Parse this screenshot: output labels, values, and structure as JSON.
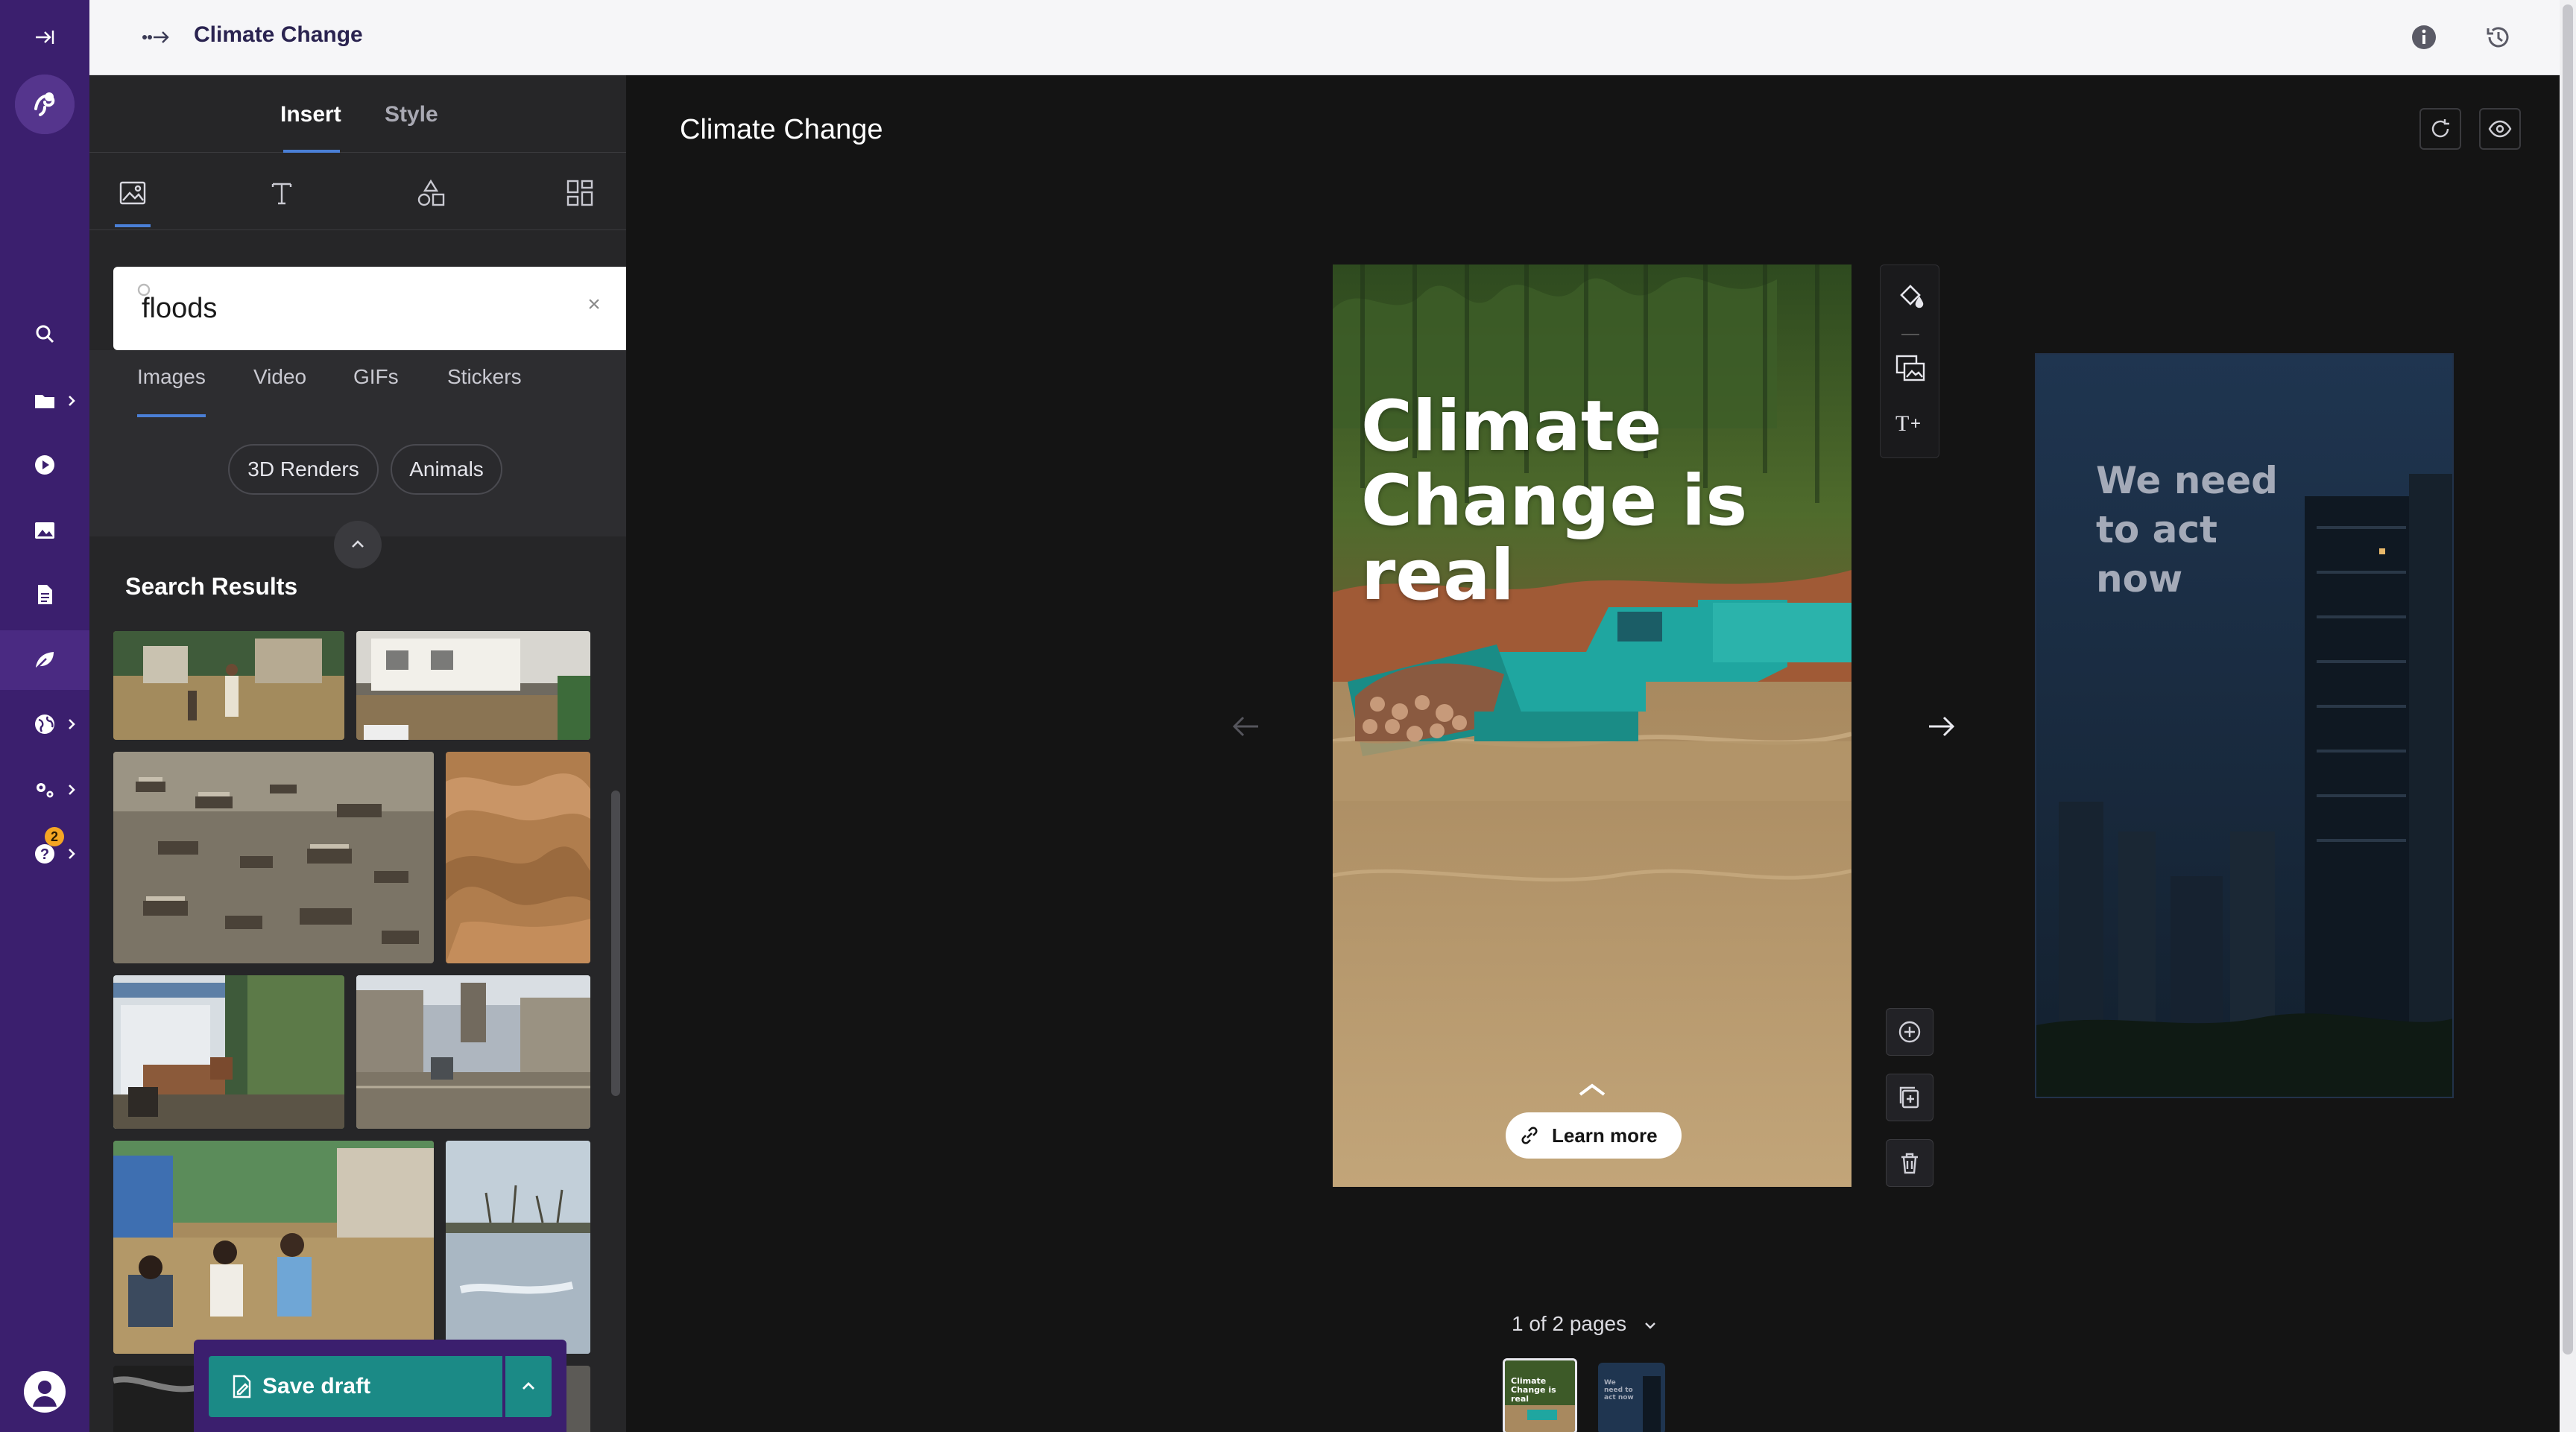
{
  "app": {
    "doc_title": "Climate Change"
  },
  "rail": {
    "items": [
      {
        "name": "expand-sidebar-icon"
      },
      {
        "name": "logo-icon"
      },
      {
        "name": "search-icon"
      },
      {
        "name": "folder-icon"
      },
      {
        "name": "play-icon"
      },
      {
        "name": "image-icon"
      },
      {
        "name": "document-icon"
      },
      {
        "name": "leaf-icon"
      },
      {
        "name": "globe-icon"
      },
      {
        "name": "settings-icon"
      },
      {
        "name": "help-icon"
      }
    ],
    "help_badge": "2",
    "accent": "#3b1f6e"
  },
  "panel": {
    "tabs": [
      {
        "label": "Insert",
        "active": true
      },
      {
        "label": "Style",
        "active": false
      }
    ],
    "tools": [
      "image-tool-icon",
      "text-tool-icon",
      "shapes-tool-icon",
      "layout-tool-icon"
    ],
    "search": {
      "value": "floods"
    },
    "media_tabs": [
      {
        "label": "Images",
        "active": true
      },
      {
        "label": "Video"
      },
      {
        "label": "GIFs"
      },
      {
        "label": "Stickers"
      }
    ],
    "filters": [
      "3D Renders",
      "Animals"
    ],
    "results_title": "Search Results",
    "save_label": "Save draft",
    "save_color": "#1b8a86"
  },
  "canvas": {
    "page1_headline": "Climate Change is real",
    "page1_cta": "Learn more",
    "page2_headline": "We need to act now",
    "pager": "1 of 2 pages",
    "current_page": 1,
    "total_pages": 2
  }
}
